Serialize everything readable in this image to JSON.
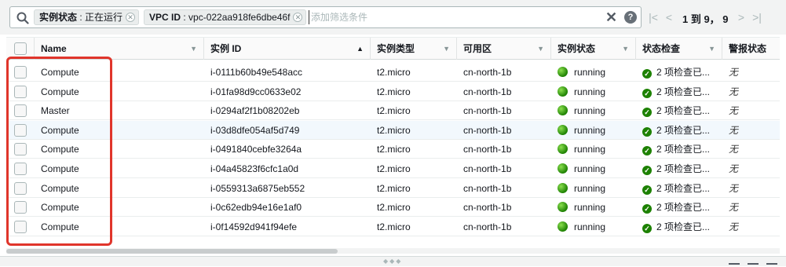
{
  "filter": {
    "search_icon": "search-icon",
    "tokens": [
      {
        "key": "实例状态",
        "value": "正在运行"
      },
      {
        "key": "VPC ID",
        "value": "vpc-022aa918fe6dbe46f"
      }
    ],
    "placeholder": "添加筛选条件",
    "clear_icon": "close-icon",
    "help_icon": "help-icon",
    "help_glyph": "?"
  },
  "pagination": {
    "text": "1 到 9， 9",
    "icons": [
      "first-page-icon",
      "prev-page-icon",
      "next-page-icon",
      "last-page-icon"
    ]
  },
  "table": {
    "columns": [
      "Name",
      "实例 ID",
      "实例类型",
      "可用区",
      "实例状态",
      "状态检查",
      "警报状态"
    ],
    "sorted_column": "实例 ID",
    "sort_direction": "ascending",
    "rows": [
      {
        "name": "Compute",
        "id": "i-0111b60b49e548acc",
        "type": "t2.micro",
        "az": "cn-north-1b",
        "state": "running",
        "check": "2 项检查已...",
        "alarm": "无"
      },
      {
        "name": "Compute",
        "id": "i-01fa98d9cc0633e02",
        "type": "t2.micro",
        "az": "cn-north-1b",
        "state": "running",
        "check": "2 项检查已...",
        "alarm": "无"
      },
      {
        "name": "Master",
        "id": "i-0294af2f1b08202eb",
        "type": "t2.micro",
        "az": "cn-north-1b",
        "state": "running",
        "check": "2 项检查已...",
        "alarm": "无"
      },
      {
        "name": "Compute",
        "id": "i-03d8dfe054af5d749",
        "type": "t2.micro",
        "az": "cn-north-1b",
        "state": "running",
        "check": "2 项检查已...",
        "alarm": "无"
      },
      {
        "name": "Compute",
        "id": "i-0491840cebfe3264a",
        "type": "t2.micro",
        "az": "cn-north-1b",
        "state": "running",
        "check": "2 项检查已...",
        "alarm": "无"
      },
      {
        "name": "Compute",
        "id": "i-04a45823f6cfc1a0d",
        "type": "t2.micro",
        "az": "cn-north-1b",
        "state": "running",
        "check": "2 项检查已...",
        "alarm": "无"
      },
      {
        "name": "Compute",
        "id": "i-0559313a6875eb552",
        "type": "t2.micro",
        "az": "cn-north-1b",
        "state": "running",
        "check": "2 项检查已...",
        "alarm": "无"
      },
      {
        "name": "Compute",
        "id": "i-0c62edb94e16e1af0",
        "type": "t2.micro",
        "az": "cn-north-1b",
        "state": "running",
        "check": "2 项检查已...",
        "alarm": "无"
      },
      {
        "name": "Compute",
        "id": "i-0f14592d941f94efe",
        "type": "t2.micro",
        "az": "cn-north-1b",
        "state": "running",
        "check": "2 项检查已...",
        "alarm": "无"
      }
    ]
  },
  "colors": {
    "accent_highlight": "#e0352b",
    "running": "#1d8102",
    "selected_row": "#f2f8fd"
  }
}
